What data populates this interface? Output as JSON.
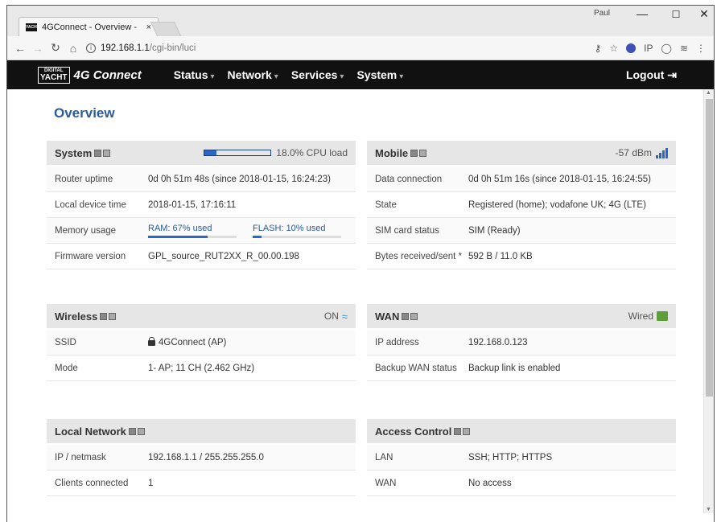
{
  "browser": {
    "tab_title": "4GConnect - Overview -",
    "tab_close": "×",
    "profile_name": "Paul",
    "url_host": "192.168.1.1",
    "url_path": "/cgi-bin/luci",
    "window_controls": {
      "minimize": "—",
      "maximize": "☐",
      "close": "✕"
    }
  },
  "nav": {
    "logo_top": "DIGITAL",
    "logo_bottom": "YACHT",
    "brand": "4G Connect",
    "menu": [
      {
        "label": "Status"
      },
      {
        "label": "Network"
      },
      {
        "label": "Services"
      },
      {
        "label": "System"
      }
    ],
    "logout": "Logout"
  },
  "page_title": "Overview",
  "panels": {
    "system": {
      "title": "System",
      "cpu_label": "18.0% CPU load",
      "cpu_fraction": 0.18,
      "rows": [
        {
          "k": "Router uptime",
          "v": "0d 0h 51m 48s (since 2018-01-15, 16:24:23)"
        },
        {
          "k": "Local device time",
          "v": "2018-01-15, 17:16:11"
        },
        {
          "k": "Memory usage",
          "v": ""
        },
        {
          "k": "Firmware version",
          "v": "GPL_source_RUT2XX_R_00.00.198"
        }
      ],
      "ram_label": "RAM: 67% used",
      "ram_fraction": 0.67,
      "flash_label": "FLASH: 10% used",
      "flash_fraction": 0.1
    },
    "mobile": {
      "title": "Mobile",
      "signal": "-57 dBm",
      "rows": [
        {
          "k": "Data connection",
          "v": "0d 0h 51m 16s (since 2018-01-15, 16:24:55)"
        },
        {
          "k": "State",
          "v": "Registered (home); vodafone UK; 4G (LTE)"
        },
        {
          "k": "SIM card status",
          "v": "SIM (Ready)"
        },
        {
          "k": "Bytes received/sent *",
          "v": "592 B / 11.0 KB"
        }
      ]
    },
    "wireless": {
      "title": "Wireless",
      "status": "ON",
      "rows": [
        {
          "k": "SSID",
          "v": "4GConnect (AP)"
        },
        {
          "k": "Mode",
          "v": "1- AP; 11 CH (2.462 GHz)"
        }
      ]
    },
    "wan": {
      "title": "WAN",
      "status": "Wired",
      "rows": [
        {
          "k": "IP address",
          "v": "192.168.0.123"
        },
        {
          "k": "Backup WAN status",
          "v": "Backup link is enabled"
        }
      ]
    },
    "local_network": {
      "title": "Local Network",
      "rows": [
        {
          "k": "IP / netmask",
          "v": "192.168.1.1 / 255.255.255.0"
        },
        {
          "k": "Clients connected",
          "v": "1"
        }
      ]
    },
    "access_control": {
      "title": "Access Control",
      "rows": [
        {
          "k": "LAN",
          "v": "SSH; HTTP; HTTPS"
        },
        {
          "k": "WAN",
          "v": "No access"
        }
      ]
    }
  },
  "colors": {
    "accent": "#2b67c4",
    "title": "#2a5b9e",
    "navbar": "#111111"
  }
}
